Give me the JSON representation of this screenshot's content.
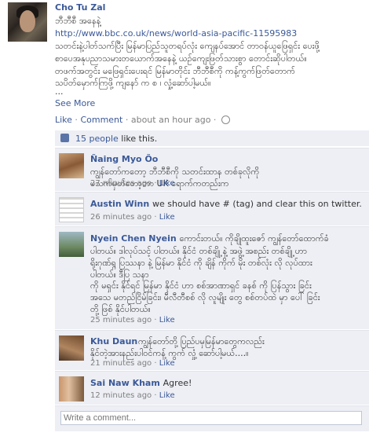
{
  "post": {
    "author": "Cho Tu Zal",
    "lines": [
      "ဘီဘီစီ အနေနဲ့",
      "http://www.bbc.co.uk/news/world-asia-pacific-11595983",
      "သတင်းနဲ့ပါတ်သက်ပြီး မြန်မာပြည်သူတရပ်လုံး ကျေနပ်အောင် တာဝန်ယူဖြေရှင်း ပေးဖို့",
      "စာပေအနုပညာသမားတယောက်အနေနဲ့ ယဉ်ကျေးဖြတ်သားစွာ တောင်းဆိုပါတယ်။",
      "တဖက်အတွင်း မဖြေရှင်းပေးရင် မြန်မာတိုင်း ဘီဘီစီကို ကန့်ကွက်ဖြတ်တောက်",
      "သပိတ်မှောက်ကြဖို့ ကျနော် က စ ၊ လှုံ့ဆော်ပါ့မယ်။",
      "..."
    ],
    "see_more": "See More",
    "actions": {
      "like": "Like",
      "separator": " · ",
      "comment": "Comment",
      "time": "about an hour ago"
    }
  },
  "likes": {
    "count_link": "15 people",
    "suffix": " like this."
  },
  "comments": [
    {
      "name": "Ñaing Myo Õo",
      "lines": [
        "ကျွန်တော်ကတော့ ဘီဘီစီကို သတင်းထာန တစ်ခုလိုကို",
        "မသက်မှတ်တော့ဘာ UK ရောက်ကတည်းက"
      ],
      "time": "27 minutes ago",
      "like": "Like"
    },
    {
      "name": "Austin Winn",
      "lines": [
        "we should have # (tag) and clear this on twitter."
      ],
      "time": "26 minutes ago",
      "like": "Like"
    },
    {
      "name": "Nyein Chen Nyein",
      "lines": [
        "ကောင်းတယ်။ ကိုချိုထူးဇော် ကျွန်တော်ထောက်ခံ",
        "ပါတယ်။ ဒါလုပ်သင့် ပါတယ်။ နိုင်ငံ တစ်ချို့ နဲ့ အဖွဲ့ အစည်း တစ်ချို့ ဟာ",
        "ရိုးဂုဏ်ရ္ဂ ပြဿနာ နဲ့ မြန်မာ နိုင်ငံ ကို ချိန် ကိုက် မိုး တစ်လုံး လို လုပ်ထား",
        "ပါတယ်။ ဒီပြ သနာ",
        "ကို မရှင်း နိုင်ရင် မြန်မာ နိုင်ငံ ဟာ စစ်အာဏာရှင် ခနစ် ကို ပြန်သွား ခြင်း",
        "အသေ မတည်ငြိမ်ခြင်း၊ မီလီတီစစ် လို လူမျိုး တွေ စစ်တပ်ထဲ မှာ ပေါ် ခြင်း",
        "တို့ ဖြစ် နိုင်ပါတယ်။"
      ],
      "time": "25 minutes ago",
      "like": "Like"
    },
    {
      "name": "Khu Daun",
      "lines": [
        "ကျွန်တော်တို့ ပြည်ပမှမြန်မာတွေကလည်း",
        "နိုင်တဲ့အားနည်းပါဝင်ကန့် ကွက် လှုံ့ ဆော်ပါ့မယ်....။"
      ],
      "time": "21 minutes ago",
      "like": "Like"
    },
    {
      "name": "Sai Naw Kham",
      "lines": [
        "Agree!"
      ],
      "time": "12 minutes ago",
      "like": "Like"
    }
  ],
  "composer": {
    "placeholder": "Write a comment..."
  },
  "colors": {
    "link": "#3b5998",
    "panel": "#edeff4",
    "meta": "#7f7f7f"
  }
}
